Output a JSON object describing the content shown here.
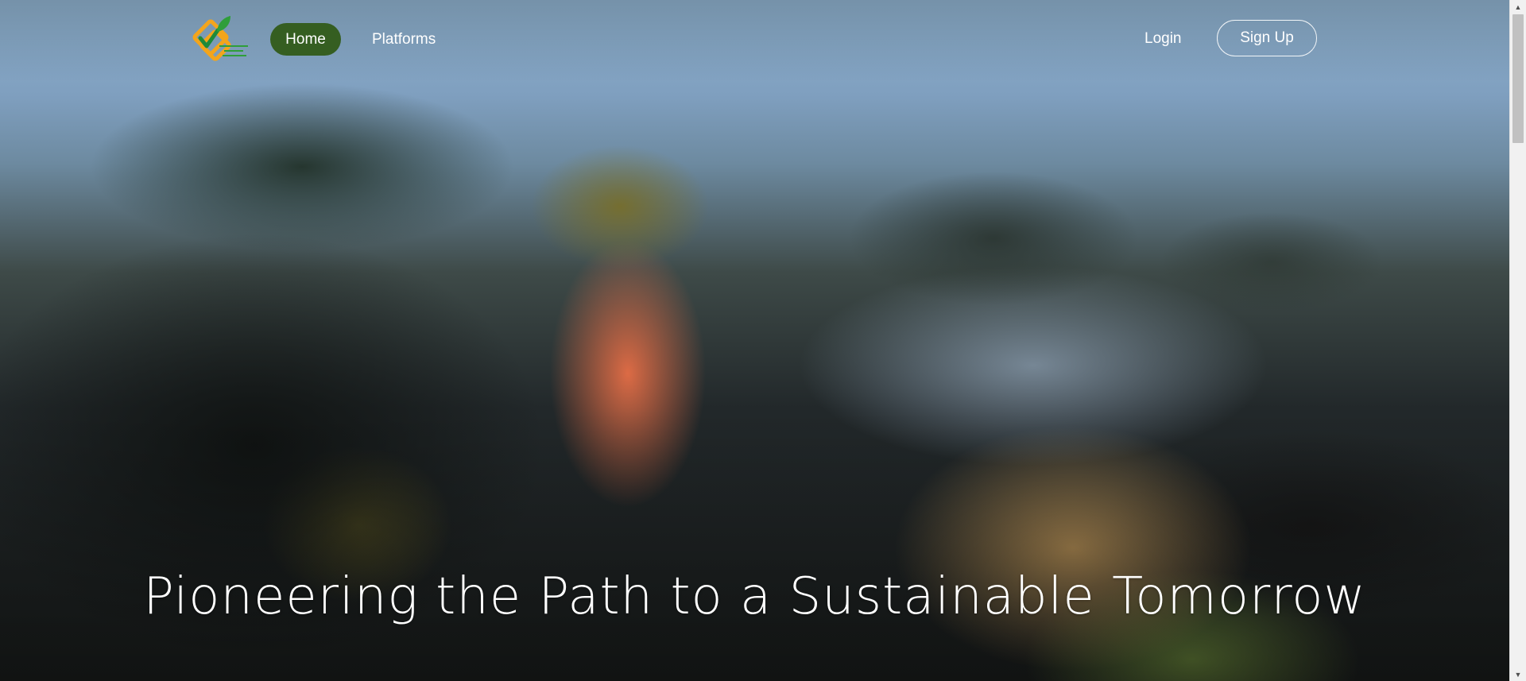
{
  "nav": {
    "home_label": "Home",
    "platforms_label": "Platforms",
    "login_label": "Login",
    "signup_label": "Sign Up",
    "logo_icon": "leaf-check-diamond-logo",
    "active_color": "#355e21"
  },
  "hero": {
    "headline": "Pioneering the Path to a Sustainable Tomorrow"
  },
  "scrollbar": {
    "up_glyph": "▲",
    "down_glyph": "▼"
  }
}
